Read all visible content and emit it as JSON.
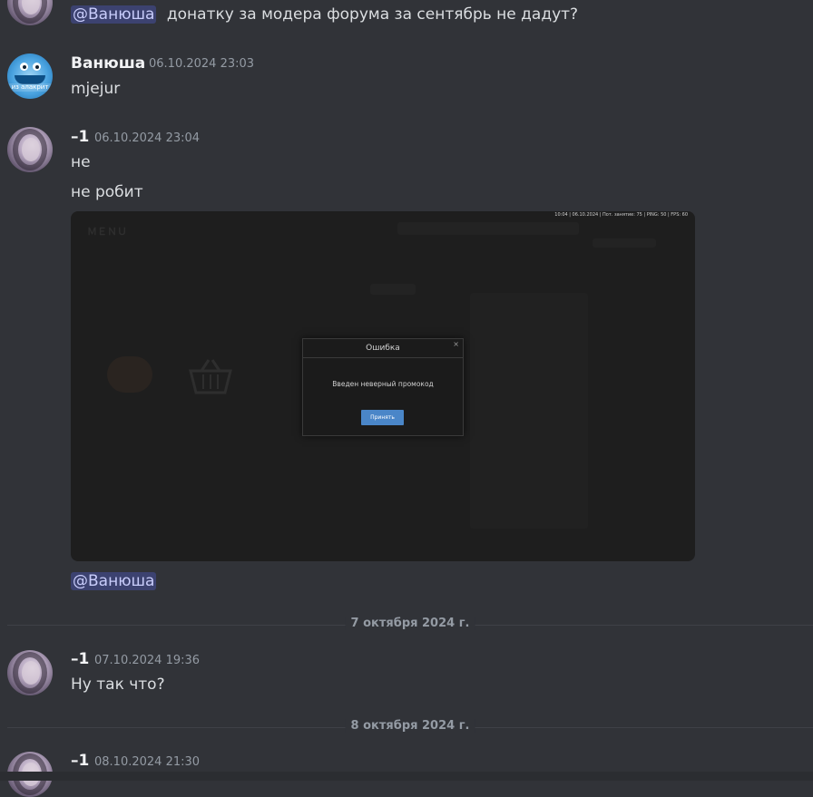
{
  "messages": {
    "top": {
      "mention": "@Ванюша",
      "text": "донатку за модера форума за сентябрь не дадут?"
    },
    "vanyusha": {
      "username": "Ванюша",
      "timestamp": "06.10.2024 23:03",
      "text": "mjejur",
      "avatar_caption": "из алакрит"
    },
    "user1_a": {
      "username": "–1",
      "timestamp": "06.10.2024 23:04",
      "lines": [
        "не",
        "не робит"
      ],
      "mention": "@Ванюша"
    },
    "user1_b": {
      "username": "–1",
      "timestamp": "07.10.2024 19:36",
      "text": "Ну так что?"
    },
    "user1_c": {
      "username": "–1",
      "timestamp": "08.10.2024 21:30"
    }
  },
  "dividers": {
    "oct7": "7 октября 2024 г.",
    "oct8": "8 октября 2024 г."
  },
  "attachment": {
    "hud_text": "10:04 | 06.10.2024 | Пот. занятие: 75 | PING: 50 | FPS: 60",
    "dialog": {
      "title": "Ошибка",
      "message": "Введен неверный промокод",
      "button": "Принять",
      "close_glyph": "×"
    }
  },
  "colors": {
    "background": "#313338",
    "mention_bg": "#3c4270",
    "mention_fg": "#c9cdfb",
    "timestamp": "#949ba4",
    "dialog_button": "#4a86c8"
  },
  "icons": {
    "avatar_user1": "avatar-girl",
    "avatar_vanyusha": "avatar-fish",
    "basket": "basket-icon"
  }
}
